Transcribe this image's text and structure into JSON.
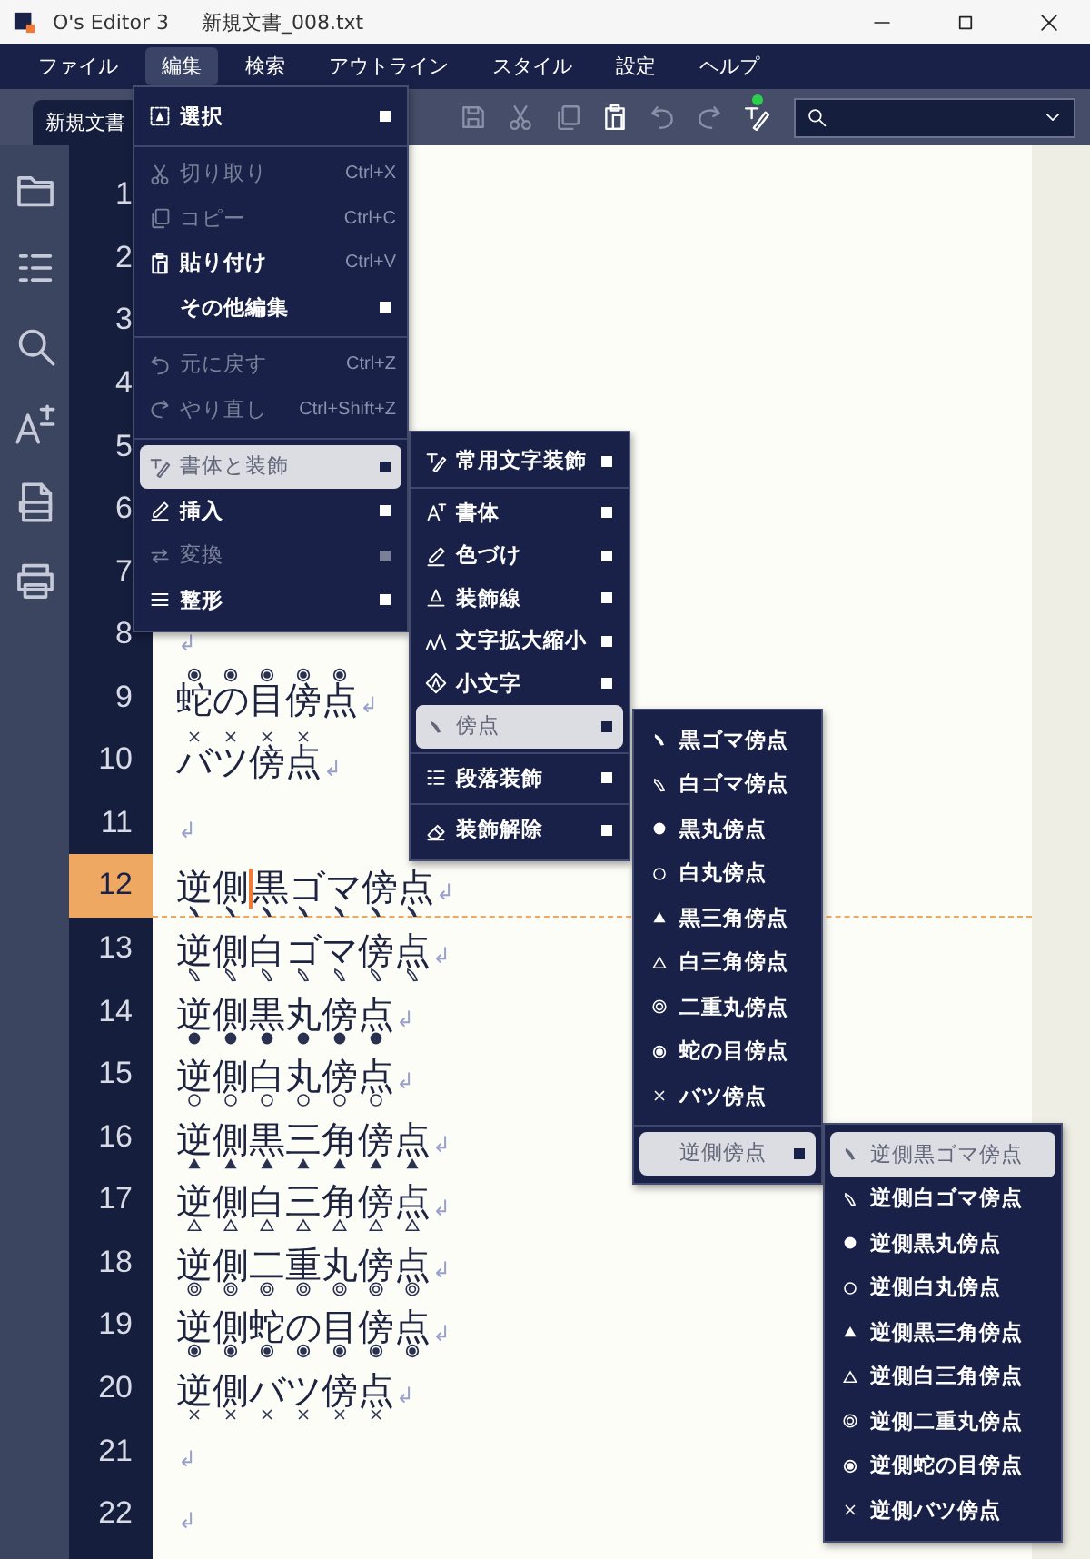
{
  "window": {
    "app_name": "O's Editor 3",
    "file_name": "新規文書_008.txt"
  },
  "menu_bar": [
    {
      "label": "ファイル",
      "selected": false
    },
    {
      "label": "編集",
      "selected": true
    },
    {
      "label": "検索",
      "selected": false
    },
    {
      "label": "アウトライン",
      "selected": false
    },
    {
      "label": "スタイル",
      "selected": false
    },
    {
      "label": "設定",
      "selected": false
    },
    {
      "label": "ヘルプ",
      "selected": false
    }
  ],
  "toolbar": {
    "tab": "新規文書",
    "buttons": [
      {
        "disabled": true,
        "badge": false
      },
      {
        "disabled": true,
        "badge": false
      },
      {
        "disabled": true,
        "badge": false
      },
      {
        "disabled": false,
        "badge": false
      },
      {
        "disabled": true,
        "badge": false
      },
      {
        "disabled": true,
        "badge": false
      },
      {
        "disabled": false,
        "badge": true
      }
    ]
  },
  "editor": {
    "lines": [
      {
        "number": "1",
        "current": false
      },
      {
        "number": "2",
        "current": false
      },
      {
        "number": "3",
        "current": false
      },
      {
        "number": "4",
        "current": false
      },
      {
        "number": "5",
        "current": false
      },
      {
        "number": "6",
        "current": false
      },
      {
        "number": "7",
        "current": false
      },
      {
        "number": "8",
        "eol": "↲",
        "current": false
      },
      {
        "number": "9",
        "text": "蛇の目傍点",
        "eol": "↲",
        "emphasis": {
          "kind": "bullseye",
          "below": false
        },
        "current": false
      },
      {
        "number": "10",
        "text": "バツ傍点",
        "eol": "↲",
        "emphasis": {
          "kind": "cross",
          "below": false
        },
        "current": false
      },
      {
        "number": "11",
        "eol": "↲",
        "current": false
      },
      {
        "number": "12",
        "text": "逆側",
        "text_after_cursor": "黒ゴマ傍点",
        "eol": "↲",
        "emphasis": {
          "kind": "sesame_black",
          "below": true
        },
        "current": true
      },
      {
        "number": "13",
        "text": "逆側白ゴマ傍点",
        "eol": "↲",
        "emphasis": {
          "kind": "sesame_white",
          "below": true
        },
        "current": false
      },
      {
        "number": "14",
        "text": "逆側黒丸傍点",
        "eol": "↲",
        "emphasis": {
          "kind": "circle_black",
          "below": true
        },
        "current": false
      },
      {
        "number": "15",
        "text": "逆側白丸傍点",
        "eol": "↲",
        "emphasis": {
          "kind": "circle_white",
          "below": true
        },
        "current": false
      },
      {
        "number": "16",
        "text": "逆側黒三角傍点",
        "eol": "↲",
        "emphasis": {
          "kind": "triangle_black",
          "below": true
        },
        "current": false
      },
      {
        "number": "17",
        "text": "逆側白三角傍点",
        "eol": "↲",
        "emphasis": {
          "kind": "triangle_white",
          "below": true
        },
        "current": false
      },
      {
        "number": "18",
        "text": "逆側二重丸傍点",
        "eol": "↲",
        "emphasis": {
          "kind": "double_circle",
          "below": true
        },
        "current": false
      },
      {
        "number": "19",
        "text": "逆側蛇の目傍点",
        "eol": "↲",
        "emphasis": {
          "kind": "bullseye",
          "below": true
        },
        "current": false
      },
      {
        "number": "20",
        "text": "逆側バツ傍点",
        "eol": "↲",
        "emphasis": {
          "kind": "cross",
          "below": true
        },
        "current": false
      },
      {
        "number": "21",
        "eol": "↲",
        "current": false
      },
      {
        "number": "22",
        "eol": "↲",
        "current": false
      }
    ]
  },
  "menus": [
    {
      "items": [
        {
          "kind": "item",
          "label": "選択",
          "submenu": true,
          "disabled": false,
          "selected": false
        },
        {
          "kind": "separator"
        },
        {
          "kind": "item",
          "label": "切り取り",
          "shortcut": "Ctrl+X",
          "submenu": false,
          "disabled": true,
          "selected": false
        },
        {
          "kind": "item",
          "label": "コピー",
          "shortcut": "Ctrl+C",
          "submenu": false,
          "disabled": true,
          "selected": false
        },
        {
          "kind": "item",
          "label": "貼り付け",
          "shortcut": "Ctrl+V",
          "submenu": false,
          "disabled": false,
          "selected": false
        },
        {
          "kind": "item",
          "label": "その他編集",
          "submenu": true,
          "disabled": false,
          "selected": false
        },
        {
          "kind": "separator"
        },
        {
          "kind": "item",
          "label": "元に戻す",
          "shortcut": "Ctrl+Z",
          "submenu": false,
          "disabled": true,
          "selected": false
        },
        {
          "kind": "item",
          "label": "やり直し",
          "shortcut": "Ctrl+Shift+Z",
          "submenu": false,
          "disabled": true,
          "selected": false
        },
        {
          "kind": "separator"
        },
        {
          "kind": "item",
          "label": "書体と装飾",
          "submenu": true,
          "disabled": false,
          "selected": true
        },
        {
          "kind": "item",
          "label": "挿入",
          "submenu": true,
          "disabled": false,
          "selected": false
        },
        {
          "kind": "item",
          "label": "変換",
          "submenu": true,
          "disabled": true,
          "selected": false
        },
        {
          "kind": "item",
          "label": "整形",
          "submenu": true,
          "disabled": false,
          "selected": false
        }
      ]
    },
    {
      "items": [
        {
          "kind": "item",
          "label": "常用文字装飾",
          "submenu": true,
          "disabled": false,
          "selected": false
        },
        {
          "kind": "separator"
        },
        {
          "kind": "item",
          "label": "書体",
          "submenu": true,
          "disabled": false,
          "selected": false
        },
        {
          "kind": "item",
          "label": "色づけ",
          "submenu": true,
          "disabled": false,
          "selected": false
        },
        {
          "kind": "item",
          "label": "装飾線",
          "submenu": true,
          "disabled": false,
          "selected": false
        },
        {
          "kind": "item",
          "label": "文字拡大縮小",
          "submenu": true,
          "disabled": false,
          "selected": false
        },
        {
          "kind": "item",
          "label": "小文字",
          "submenu": true,
          "disabled": false,
          "selected": false
        },
        {
          "kind": "item",
          "label": "傍点",
          "submenu": true,
          "disabled": false,
          "selected": true
        },
        {
          "kind": "separator"
        },
        {
          "kind": "item",
          "label": "段落装飾",
          "submenu": true,
          "disabled": false,
          "selected": false
        },
        {
          "kind": "separator"
        },
        {
          "kind": "item",
          "label": "装飾解除",
          "submenu": true,
          "disabled": false,
          "selected": false
        }
      ]
    },
    {
      "items": [
        {
          "kind": "sesame_black",
          "label": "黒ゴマ傍点",
          "submenu": false,
          "disabled": false,
          "selected": false
        },
        {
          "kind": "sesame_white",
          "label": "白ゴマ傍点",
          "submenu": false,
          "disabled": false,
          "selected": false
        },
        {
          "kind": "circle_black",
          "label": "黒丸傍点",
          "submenu": false,
          "disabled": false,
          "selected": false
        },
        {
          "kind": "circle_white",
          "label": "白丸傍点",
          "submenu": false,
          "disabled": false,
          "selected": false
        },
        {
          "kind": "triangle_black",
          "label": "黒三角傍点",
          "submenu": false,
          "disabled": false,
          "selected": false
        },
        {
          "kind": "triangle_white",
          "label": "白三角傍点",
          "submenu": false,
          "disabled": false,
          "selected": false
        },
        {
          "kind": "double_circle",
          "label": "二重丸傍点",
          "submenu": false,
          "disabled": false,
          "selected": false
        },
        {
          "kind": "bullseye",
          "label": "蛇の目傍点",
          "submenu": false,
          "disabled": false,
          "selected": false
        },
        {
          "kind": "cross",
          "label": "バツ傍点",
          "submenu": false,
          "disabled": false,
          "selected": false
        },
        {
          "kind": "separator"
        },
        {
          "kind": "item",
          "label": "逆側傍点",
          "submenu": true,
          "disabled": false,
          "selected": true
        }
      ]
    },
    {
      "items": [
        {
          "kind": "sesame_black",
          "label": "逆側黒ゴマ傍点",
          "submenu": false,
          "disabled": false,
          "selected": true
        },
        {
          "kind": "sesame_white",
          "label": "逆側白ゴマ傍点",
          "submenu": false,
          "disabled": false,
          "selected": false
        },
        {
          "kind": "circle_black",
          "label": "逆側黒丸傍点",
          "submenu": false,
          "disabled": false,
          "selected": false
        },
        {
          "kind": "circle_white",
          "label": "逆側白丸傍点",
          "submenu": false,
          "disabled": false,
          "selected": false
        },
        {
          "kind": "triangle_black",
          "label": "逆側黒三角傍点",
          "submenu": false,
          "disabled": false,
          "selected": false
        },
        {
          "kind": "triangle_white",
          "label": "逆側白三角傍点",
          "submenu": false,
          "disabled": false,
          "selected": false
        },
        {
          "kind": "double_circle",
          "label": "逆側二重丸傍点",
          "submenu": false,
          "disabled": false,
          "selected": false
        },
        {
          "kind": "bullseye",
          "label": "逆側蛇の目傍点",
          "submenu": false,
          "disabled": false,
          "selected": false
        },
        {
          "kind": "cross",
          "label": "逆側バツ傍点",
          "submenu": false,
          "disabled": false,
          "selected": false
        }
      ]
    }
  ]
}
